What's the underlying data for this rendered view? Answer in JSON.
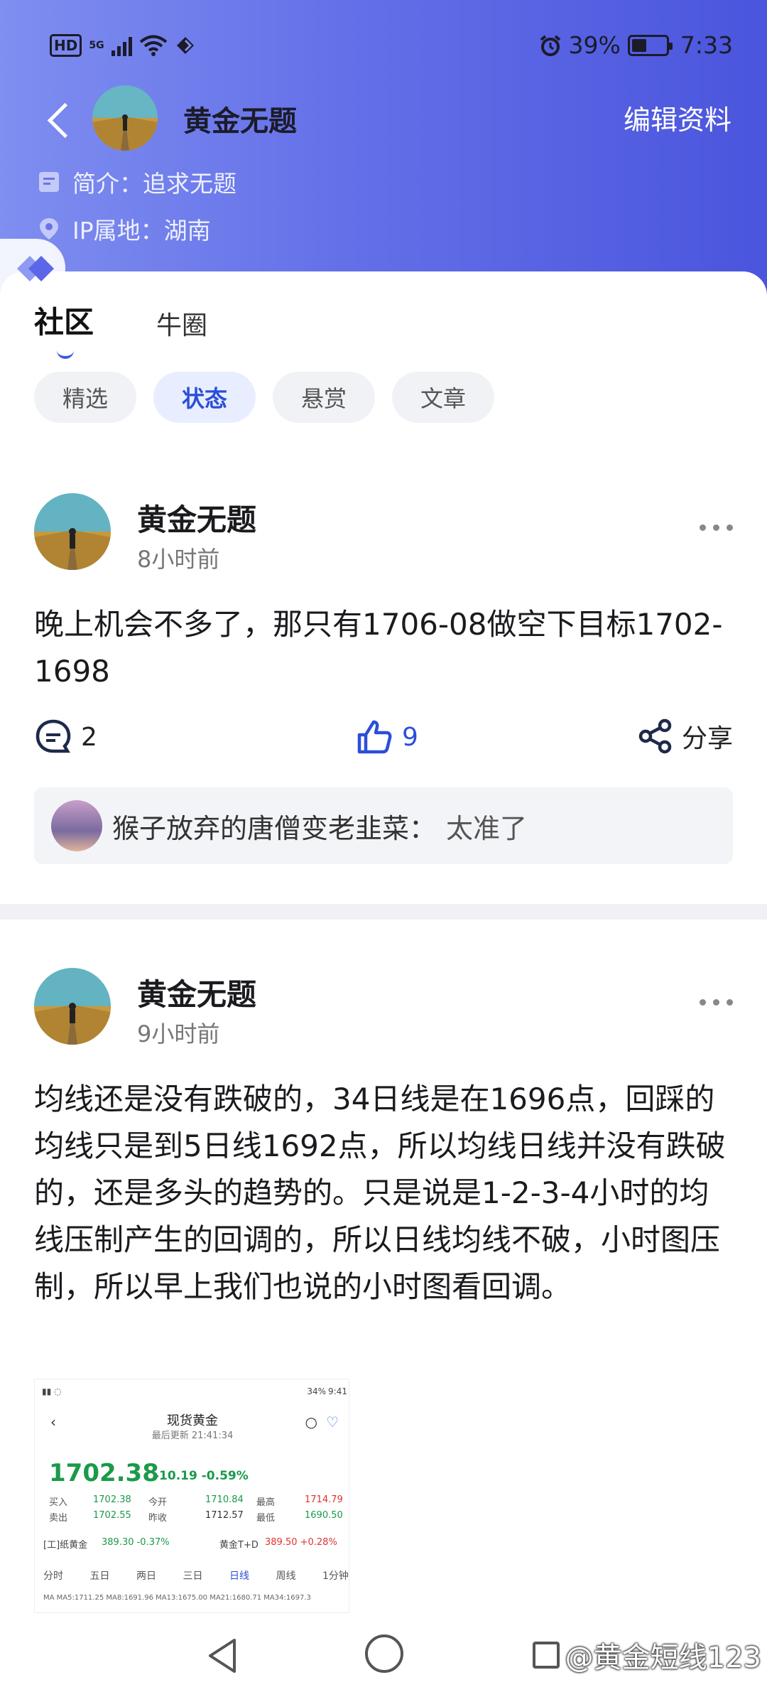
{
  "status_bar": {
    "network_badge": "HD",
    "signal_label": "5G",
    "battery_percent": "39%",
    "time": "7:33",
    "icons": [
      "hd-icon",
      "signal-icon",
      "wifi-icon",
      "nfc-icon",
      "alarm-icon",
      "battery-icon"
    ]
  },
  "profile_header": {
    "name": "黄金无题",
    "edit_label": "编辑资料",
    "intro": "简介：追求无题",
    "ip_location": "IP属地：湖南"
  },
  "tabs": [
    {
      "label": "社区",
      "active": true
    },
    {
      "label": "牛圈",
      "active": false
    }
  ],
  "chips": [
    {
      "label": "精选",
      "active": false
    },
    {
      "label": "状态",
      "active": true
    },
    {
      "label": "悬赏",
      "active": false
    },
    {
      "label": "文章",
      "active": false
    }
  ],
  "posts": [
    {
      "author": "黄金无题",
      "time": "8小时前",
      "text": "晚上机会不多了，那只有1706-08做空下目标1702-1698",
      "comments": "2",
      "likes": "9",
      "share_label": "分享",
      "top_comment": {
        "user": "猴子放弃的唐僧变老韭菜：",
        "text": "太准了"
      }
    },
    {
      "author": "黄金无题",
      "time": "9小时前",
      "text": "均线还是没有跌破的，34日线是在1696点，回踩的均线只是到5日线1692点，所以均线日线并没有跌破的，还是多头的趋势的。只是说是1-2-3-4小时的均线压制产生的回调的，所以日线均线不破，小时图压制，所以早上我们也说的小时图看回调。",
      "image": {
        "status_battery": "34%",
        "status_time": "9:41",
        "title": "现货黄金",
        "updated": "最后更新  21:41:34",
        "price": "1702.38",
        "change": "-10.19 -0.59%",
        "buy_label": "买入",
        "buy": "1702.38",
        "sell_label": "卖出",
        "sell": "1702.55",
        "open_label": "今开",
        "open": "1710.84",
        "prev_label": "昨收",
        "prev": "1712.57",
        "high_label": "最高",
        "high": "1714.79",
        "low_label": "最低",
        "low": "1690.50",
        "paper_gold": "[工]纸黄金",
        "paper_gold_val": "389.30 -0.37%",
        "td_gold": "黄金T+D",
        "td_gold_val": "389.50 +0.28%",
        "period_tabs": [
          "分时",
          "五日",
          "两日",
          "三日",
          "日线",
          "周线",
          "1分钟"
        ],
        "ma_line": "MA  MA5:1711.25  MA8:1691.96  MA13:1675.00  MA21:1680.71  MA34:1697.3"
      }
    }
  ],
  "watermark": "@黄金短线123",
  "colors": {
    "header_start": "#7f8ef0",
    "header_end": "#4a55dd",
    "accent": "#2b4fd8",
    "price_green": "#1a9a4a"
  }
}
